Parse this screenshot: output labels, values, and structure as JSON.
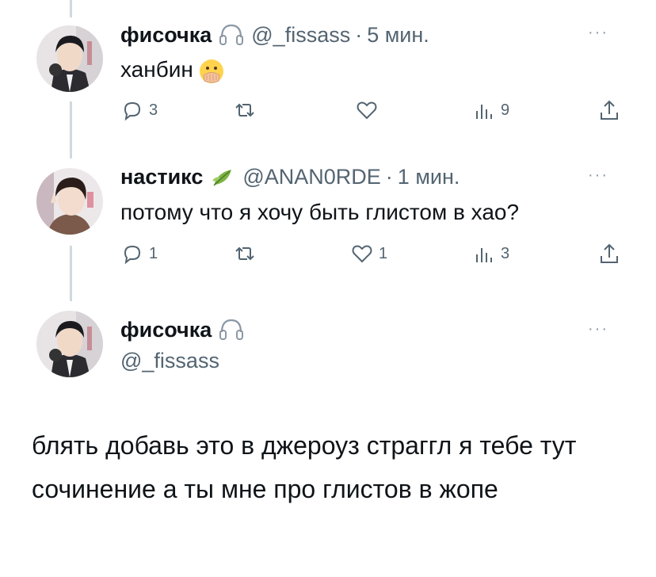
{
  "thread": [
    {
      "display_name": "фисочка",
      "name_icon": "airpods-max-icon",
      "handle": "@_fissass",
      "separator": "·",
      "time": "5 мин.",
      "text": "ханбин",
      "text_emoji": "face-with-open-eyes-and-hand-over-mouth-emoji",
      "more": "···",
      "stats": {
        "replies": "3",
        "retweets": "",
        "likes": "",
        "views": "9"
      }
    },
    {
      "display_name": "настикс",
      "name_icon": "herb-leaf-icon",
      "handle": "@ANAN0RDE",
      "separator": "·",
      "time": "1 мин.",
      "text": "потому что я хочу быть глистом в хао?",
      "more": "···",
      "stats": {
        "replies": "1",
        "retweets": "",
        "likes": "1",
        "views": "3"
      }
    }
  ],
  "main_tweet": {
    "display_name": "фисочка",
    "name_icon": "airpods-max-icon",
    "handle": "@_fissass",
    "more": "···",
    "text": "блять добавь это в джероуз страггл я тебе тут сочинение а ты мне про глистов в жопе"
  },
  "colors": {
    "text": "#0f1419",
    "secondary": "#536471",
    "line": "#cfd9de",
    "leaf": "#6aa84f"
  }
}
